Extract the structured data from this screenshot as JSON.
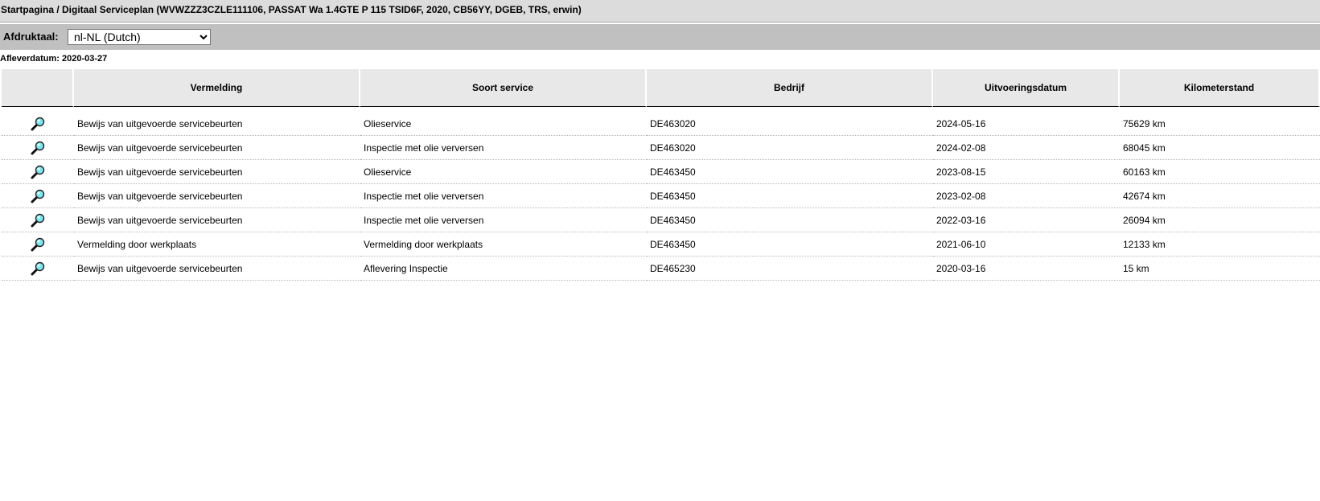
{
  "breadcrumb": {
    "text": "Startpagina / Digitaal Serviceplan (WVWZZZ3CZLE111106, PASSAT Wa 1.4GTE P 115 TSID6F, 2020, CB56YY, DGEB, TRS, erwin)"
  },
  "print_language": {
    "label": "Afdruktaal:",
    "selected": "nl-NL (Dutch)"
  },
  "delivery_date": {
    "text": "Afleverdatum: 2020-03-27"
  },
  "table": {
    "columns": [
      "",
      "Vermelding",
      "Soort service",
      "Bedrijf",
      "Uitvoeringsdatum",
      "Kilometerstand"
    ],
    "rows": [
      {
        "vermelding": "Bewijs van uitgevoerde servicebeurten",
        "soort_service": "Olieservice",
        "bedrijf": "DE463020",
        "datum": "2024-05-16",
        "km": "75629 km"
      },
      {
        "vermelding": "Bewijs van uitgevoerde servicebeurten",
        "soort_service": "Inspectie met olie verversen",
        "bedrijf": "DE463020",
        "datum": "2024-02-08",
        "km": "68045 km"
      },
      {
        "vermelding": "Bewijs van uitgevoerde servicebeurten",
        "soort_service": "Olieservice",
        "bedrijf": "DE463450",
        "datum": "2023-08-15",
        "km": "60163 km"
      },
      {
        "vermelding": "Bewijs van uitgevoerde servicebeurten",
        "soort_service": "Inspectie met olie verversen",
        "bedrijf": "DE463450",
        "datum": "2023-02-08",
        "km": "42674 km"
      },
      {
        "vermelding": "Bewijs van uitgevoerde servicebeurten",
        "soort_service": "Inspectie met olie verversen",
        "bedrijf": "DE463450",
        "datum": "2022-03-16",
        "km": "26094 km"
      },
      {
        "vermelding": "Vermelding door werkplaats",
        "soort_service": "Vermelding door werkplaats",
        "bedrijf": "DE463450",
        "datum": "2021-06-10",
        "km": "12133 km"
      },
      {
        "vermelding": "Bewijs van uitgevoerde servicebeurten",
        "soort_service": "Aflevering Inspectie",
        "bedrijf": "DE465230",
        "datum": "2020-03-16",
        "km": "15 km"
      }
    ],
    "row_icon": "magnifier-icon"
  },
  "colors": {
    "header_bar": "#dcdcdc",
    "language_bar": "#c0c0c0",
    "table_header": "#e8e8e8",
    "icon_lens": "#7fe6f0"
  }
}
